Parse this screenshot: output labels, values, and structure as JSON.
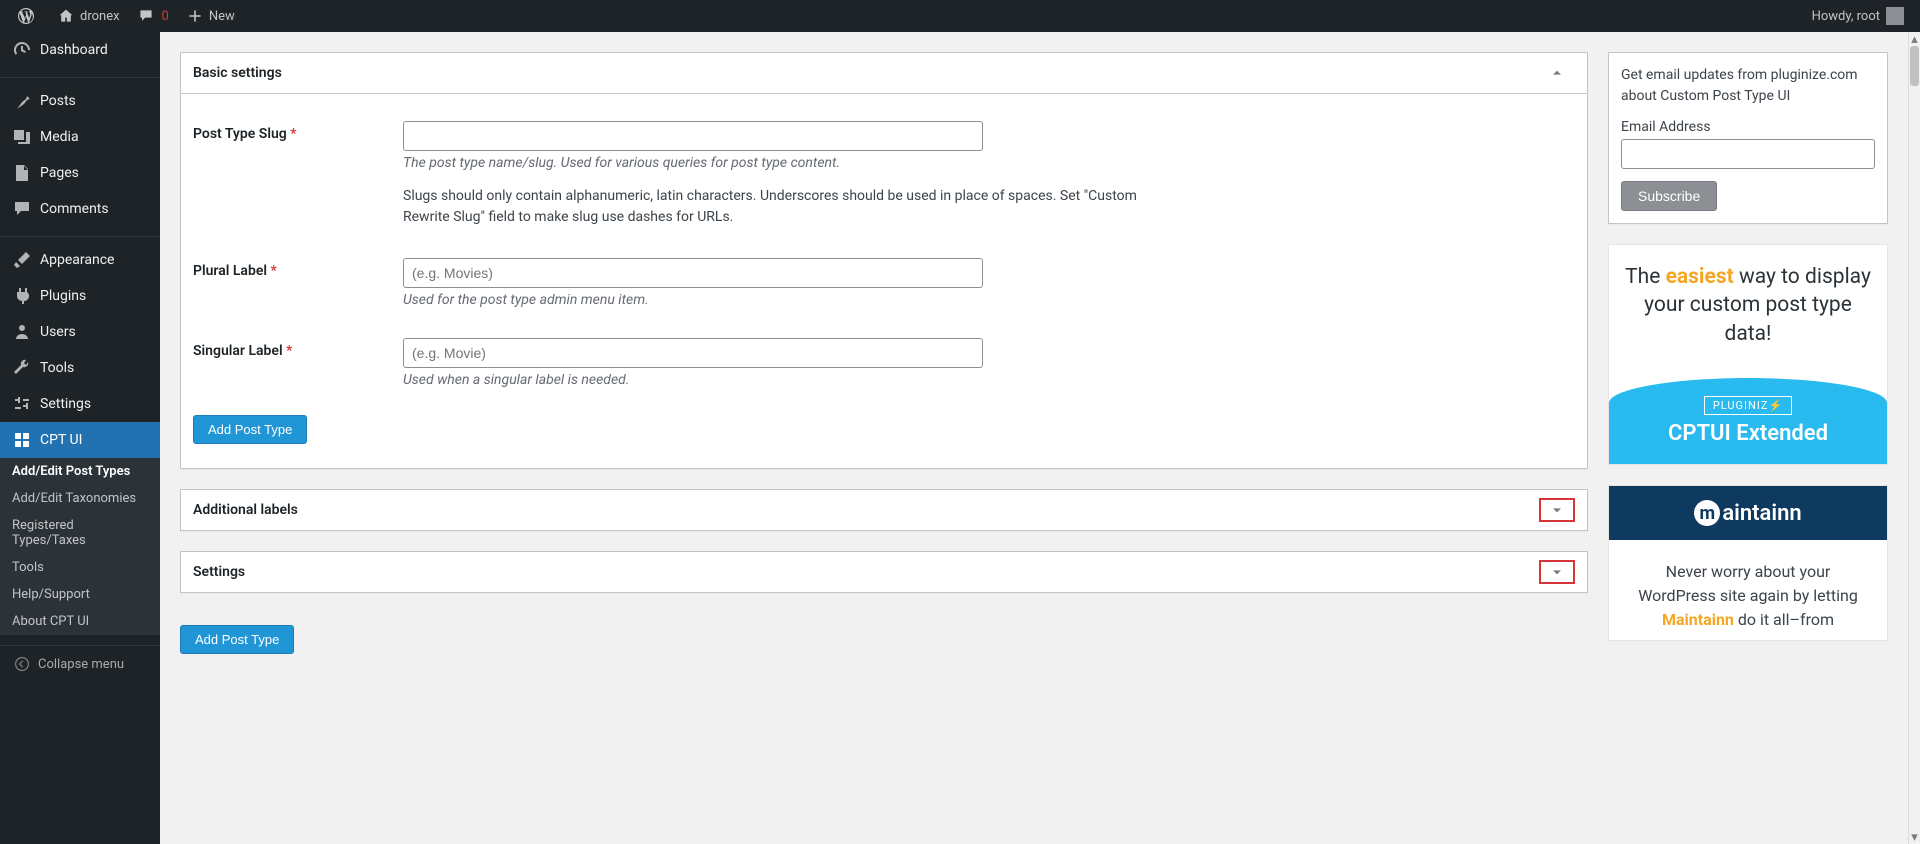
{
  "adminbar": {
    "site_name": "dronex",
    "comment_count": "0",
    "new_label": "New",
    "howdy": "Howdy, root"
  },
  "sidebar": {
    "items": [
      {
        "label": "Dashboard",
        "icon": "dashboard"
      },
      {
        "label": "Posts",
        "icon": "pin"
      },
      {
        "label": "Media",
        "icon": "media"
      },
      {
        "label": "Pages",
        "icon": "page"
      },
      {
        "label": "Comments",
        "icon": "comment"
      },
      {
        "label": "Appearance",
        "icon": "brush"
      },
      {
        "label": "Plugins",
        "icon": "plug"
      },
      {
        "label": "Users",
        "icon": "user"
      },
      {
        "label": "Tools",
        "icon": "wrench"
      },
      {
        "label": "Settings",
        "icon": "sliders"
      },
      {
        "label": "CPT UI",
        "icon": "grid"
      }
    ],
    "submenu": [
      "Add/Edit Post Types",
      "Add/Edit Taxonomies",
      "Registered Types/Taxes",
      "Tools",
      "Help/Support",
      "About CPT UI"
    ],
    "collapse_label": "Collapse menu"
  },
  "panels": {
    "basic": {
      "title": "Basic settings",
      "slug": {
        "label": "Post Type Slug",
        "desc1": "The post type name/slug. Used for various queries for post type content.",
        "desc2": "Slugs should only contain alphanumeric, latin characters. Underscores should be used in place of spaces. Set \"Custom Rewrite Slug\" field to make slug use dashes for URLs."
      },
      "plural": {
        "label": "Plural Label",
        "placeholder": "(e.g. Movies)",
        "desc": "Used for the post type admin menu item."
      },
      "singular": {
        "label": "Singular Label",
        "placeholder": "(e.g. Movie)",
        "desc": "Used when a singular label is needed."
      },
      "submit": "Add Post Type"
    },
    "additional": {
      "title": "Additional labels"
    },
    "settings_panel": {
      "title": "Settings"
    },
    "submit_bottom": "Add Post Type"
  },
  "widgets": {
    "newsletter": {
      "text": "Get email updates from pluginize.com about Custom Post Type UI",
      "email_label": "Email Address",
      "subscribe": "Subscribe"
    },
    "ad1": {
      "line1_a": "The ",
      "line1_b": "easiest",
      "line1_c": " way to display your custom post type data!",
      "badge": "PLUGINIZ⚡",
      "banner_title": "CPTUI Extended"
    },
    "ad2": {
      "logo_text": "aintainn",
      "body_a": "Never worry about your WordPress site again by letting ",
      "body_b": "Maintainn",
      "body_c": " do it all–from"
    }
  }
}
